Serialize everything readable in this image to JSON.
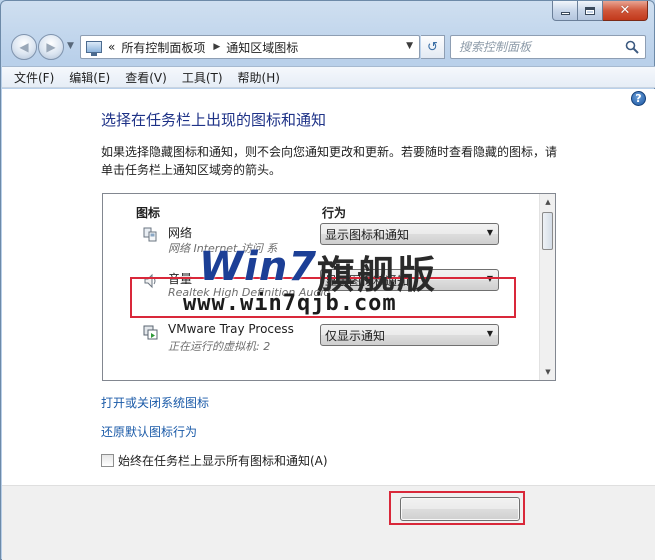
{
  "window": {
    "caption": {
      "minimize": "–",
      "close": "✕"
    }
  },
  "nav": {
    "breadcrumb_sep": "«",
    "crumbs": [
      "所有控制面板项",
      "通知区域图标"
    ],
    "crumb_arrow": "▶",
    "dropdown": "▼",
    "refresh": "↺",
    "search_placeholder": "搜索控制面板"
  },
  "menu": {
    "items": [
      "文件(F)",
      "编辑(E)",
      "查看(V)",
      "工具(T)",
      "帮助(H)"
    ]
  },
  "content": {
    "help": "?",
    "heading": "选择在任务栏上出现的图标和通知",
    "description": "如果选择隐藏图标和通知，则不会向您通知更改和更新。若要随时查看隐藏的图标，请单击任务栏上通知区域旁的箭头。",
    "columns": {
      "icon": "图标",
      "behavior": "行为"
    },
    "rows": [
      {
        "name": "网络",
        "sub": "网络 Internet 访问 系",
        "behavior": "显示图标和通知"
      },
      {
        "name": "音量",
        "sub": "Realtek High Definition Audio",
        "behavior": "显示图标和通知"
      },
      {
        "name": "VMware Tray Process",
        "sub": "正在运行的虚拟机: 2",
        "behavior": "仅显示通知"
      }
    ],
    "links": {
      "system_icons": "打开或关闭系统图标",
      "restore": "还原默认图标行为"
    },
    "always_show": "始终在任务栏上显示所有图标和通知(A)"
  },
  "watermark": {
    "brand": "Win7",
    "cn": "旗舰版",
    "url": "www.win7qjb.com"
  },
  "colors": {
    "heading": "#1e3287",
    "link": "#1a5aa8",
    "highlight": "#d9283a"
  }
}
